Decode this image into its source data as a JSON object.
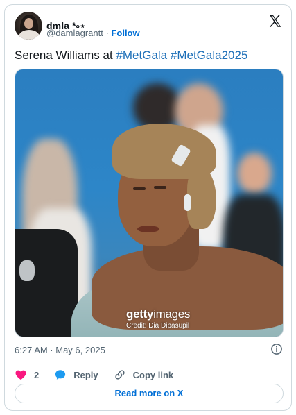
{
  "author": {
    "name": "dmla *༚⋆",
    "handle": "@damlagrantt",
    "separator": "·",
    "follow_label": "Follow"
  },
  "tweet": {
    "text_plain": "Serena Williams at ",
    "hashtag1": "#MetGala",
    "hashtag2": "#MetGala2025",
    "timestamp": "6:27 AM · May 6, 2025"
  },
  "media": {
    "watermark_brand": "getty",
    "watermark_brand_suffix": "images",
    "credit": "Credit: Dia Dipasupil"
  },
  "actions": {
    "like_count": "2",
    "reply_label": "Reply",
    "copy_label": "Copy link"
  },
  "read_more_label": "Read more on X",
  "colors": {
    "accent": "#006fd6",
    "like": "#f91880",
    "reply": "#1d9bf0",
    "muted": "#536471",
    "border": "#cfd9de"
  },
  "icons": [
    "x-logo-icon",
    "info-icon",
    "heart-icon",
    "reply-bubble-icon",
    "link-icon"
  ]
}
